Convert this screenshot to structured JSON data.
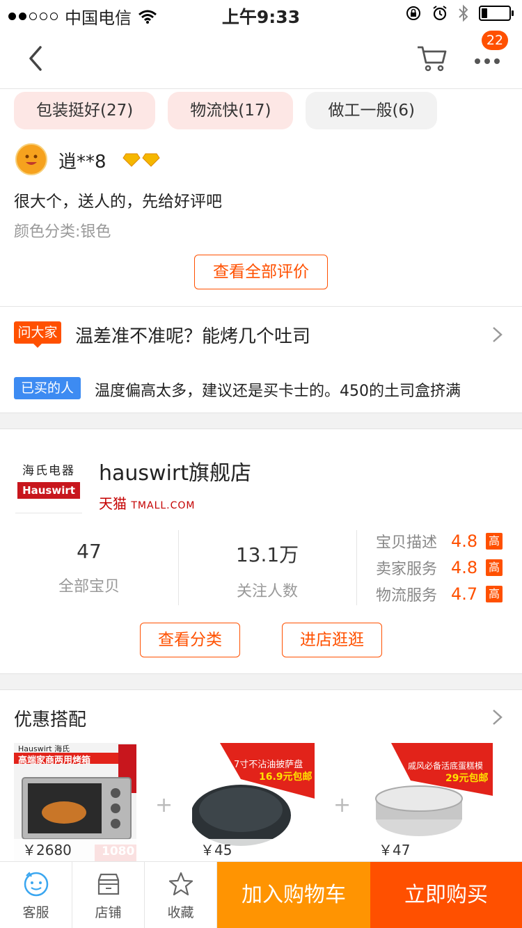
{
  "status_bar": {
    "carrier": "中国电信",
    "time": "上午9:33",
    "signal_bars_filled": 2,
    "signal_bars_total": 5,
    "battery_level": 0.2
  },
  "nav": {
    "badge_count": "22",
    "icons": [
      "back-arrow-icon",
      "cart-icon",
      "more-icon"
    ]
  },
  "review_tags": [
    {
      "label": "包装挺好(27)",
      "type": "positive"
    },
    {
      "label": "物流快(17)",
      "type": "positive"
    },
    {
      "label": "做工一般(6)",
      "type": "neutral"
    }
  ],
  "review": {
    "user": "逍**8",
    "text": "很大个，送人的，先给好评吧",
    "sku": "颜色分类:银色",
    "view_all": "查看全部评价"
  },
  "qa": {
    "ask_tag": "问大家",
    "question": "温差准不准呢？能烤几个吐司",
    "bought_tag": "已买的人",
    "answer": "温度偏高太多，建议还是买卡士的。450的土司盒挤满"
  },
  "shop": {
    "logo_cn": "海氏电器",
    "logo_en": "Hauswirt",
    "name": "hauswirt旗舰店",
    "tmall_cn": "天猫",
    "tmall_en": "TMALL.COM",
    "stats": [
      {
        "value": "47",
        "label": "全部宝贝"
      },
      {
        "value": "13.1万",
        "label": "关注人数"
      }
    ],
    "ratings": [
      {
        "label": "宝贝描述",
        "value": "4.8",
        "badge": "高"
      },
      {
        "label": "卖家服务",
        "value": "4.8",
        "badge": "高"
      },
      {
        "label": "物流服务",
        "value": "4.7",
        "badge": "高"
      }
    ],
    "btn_category": "查看分类",
    "btn_enter": "进店逛逛"
  },
  "combo": {
    "title": "优惠搭配",
    "items": [
      {
        "price": "￥2680",
        "banner": "高端家商两用烤箱",
        "brand": "Hauswirt 海氏",
        "tag": "1080"
      },
      {
        "price": "￥45",
        "banner": "7寸不沾油披萨盘",
        "sub": "16.9元包邮"
      },
      {
        "price": "￥47",
        "banner": "戚风必备活底蛋糕模",
        "sub": "29元包邮"
      }
    ],
    "plus": "+"
  },
  "bottom_bar": {
    "service": "客服",
    "shop": "店铺",
    "favorite": "收藏",
    "add_cart": "加入购物车",
    "buy_now": "立即购买"
  },
  "colors": {
    "accent": "#ff5000",
    "cart_btn": "#ff9402",
    "bought_blue": "#3d8bf2",
    "tmall_red": "#c40000"
  }
}
